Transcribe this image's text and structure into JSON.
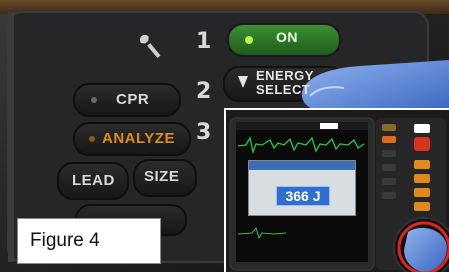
{
  "caption": "Figure 4",
  "panel": {
    "on_label": "ON",
    "energy_label_line1": "ENERGY",
    "energy_label_line2": "SELECT",
    "cpr_label": "CPR",
    "analyze_label": "ANALYZE",
    "lead_label": "LEAD",
    "size_label": "SIZE",
    "step_1": "1",
    "step_2": "2",
    "step_3": "3"
  },
  "inset": {
    "selected_energy": "366 J"
  },
  "colors": {
    "on_button": "#2f7f2a",
    "on_led": "#b9ff4a",
    "analyze_text": "#e08a1e",
    "highlight_ring": "#e0231c",
    "glove": "#4f7fd4",
    "ecg_trace": "#28c83c",
    "energy_value_bg": "#2f6fd0"
  }
}
